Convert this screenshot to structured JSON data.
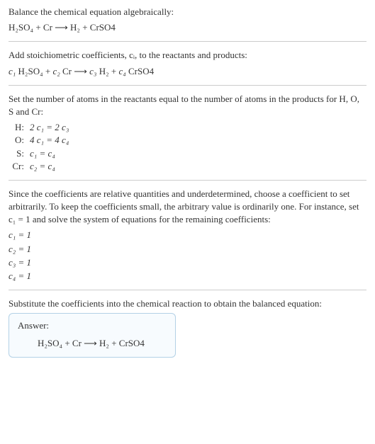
{
  "title_line": "Balance the chemical equation algebraically:",
  "eqn_main": "H₂SO₄ + Cr ⟶ H₂ + CrSO4",
  "stoich_intro": "Add stoichiometric coefficients, cᵢ, to the reactants and products:",
  "eqn_coeffs_parts": {
    "c1": "c₁",
    "sp1": " H₂SO₄ + ",
    "c2": "c₂",
    "sp2": " Cr ⟶ ",
    "c3": "c₃",
    "sp3": " H₂ + ",
    "c4": "c₄",
    "sp4": " CrSO4"
  },
  "set_atoms_text": "Set the number of atoms in the reactants equal to the number of atoms in the products for H, O, S and Cr:",
  "atom_eqs": [
    {
      "label": "H:",
      "eq": "2 c₁ = 2 c₃"
    },
    {
      "label": "O:",
      "eq": "4 c₁ = 4 c₄"
    },
    {
      "label": "S:",
      "eq": "c₁ = c₄"
    },
    {
      "label": "Cr:",
      "eq": "c₂ = c₄"
    }
  ],
  "underdet_text": "Since the coefficients are relative quantities and underdetermined, choose a coefficient to set arbitrarily. To keep the coefficients small, the arbitrary value is ordinarily one. For instance, set c₁ = 1 and solve the system of equations for the remaining coefficients:",
  "coeff_solutions": [
    "c₁ = 1",
    "c₂ = 1",
    "c₃ = 1",
    "c₄ = 1"
  ],
  "substitute_text": "Substitute the coefficients into the chemical reaction to obtain the balanced equation:",
  "answer_label": "Answer:",
  "answer_eqn": "H₂SO₄ + Cr ⟶ H₂ + CrSO4"
}
